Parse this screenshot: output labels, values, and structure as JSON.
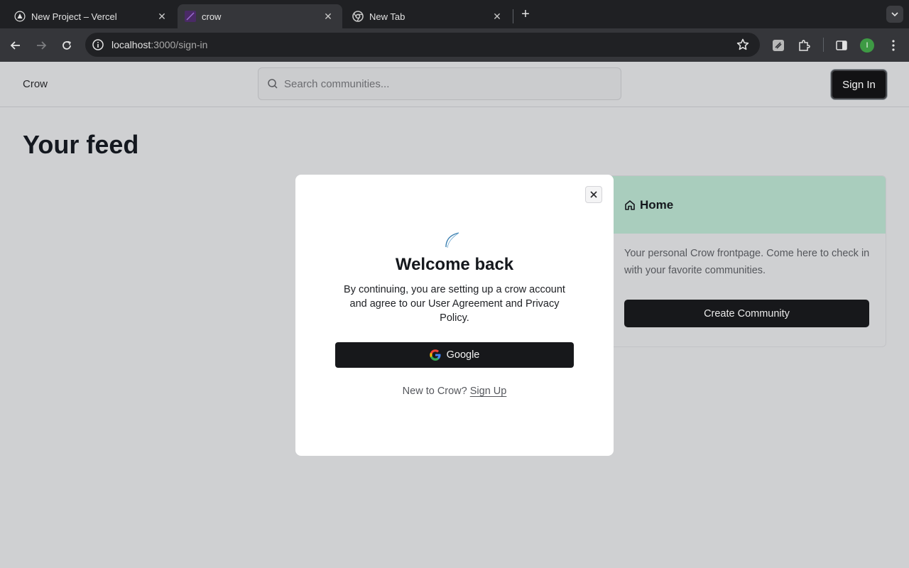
{
  "browser": {
    "tabs": [
      {
        "title": "New Project – Vercel",
        "favicon": "vercel-icon",
        "active": false
      },
      {
        "title": "crow",
        "favicon": "crow-favicon",
        "active": true
      },
      {
        "title": "New Tab",
        "favicon": "chrome-icon",
        "active": false
      }
    ],
    "url_host": "localhost",
    "url_rest": ":3000/sign-in",
    "profile_initial": "I"
  },
  "header": {
    "brand": "Crow",
    "search_placeholder": "Search communities...",
    "signin_label": "Sign In"
  },
  "main": {
    "feed_title": "Your feed"
  },
  "home_card": {
    "title": "Home",
    "description": "Your personal Crow frontpage. Come here to check in with your favorite communities.",
    "create_label": "Create Community",
    "accent_color": "#a9cdbd"
  },
  "modal": {
    "title": "Welcome back",
    "text": "By continuing, you are setting up a crow account and agree to our User Agreement and Privacy Policy.",
    "google_label": "Google",
    "footer_text": "New to Crow?",
    "signup_label": "Sign Up"
  }
}
